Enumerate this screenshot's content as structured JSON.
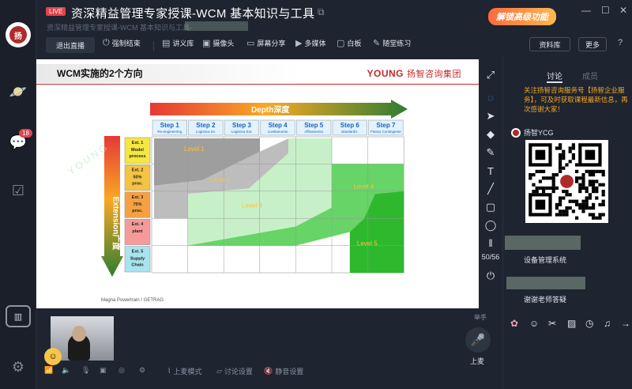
{
  "titlebar": {
    "live_badge": "LIVE",
    "title": "资深精益管理专家授课-WCM 基本知识与工具",
    "subtitle": "资深精益管理专家授课-WCM 基本知识与工具-",
    "promo": "解锁高级功能"
  },
  "toolbar": {
    "exit": "退出直播",
    "force_end": "强制结束",
    "courseware": "讲义库",
    "camera": "摄像头",
    "screen_share": "屏幕分享",
    "multimedia": "多媒体",
    "whiteboard": "白板",
    "quiz": "随堂练习",
    "resources": "资料库",
    "more": "更多"
  },
  "rail": {
    "badge": "18"
  },
  "slide": {
    "title": "WCM实施的2个方向",
    "brand": "YOUNG",
    "brand_cn": "扬智咨询集团",
    "footer": "Magna Powertrain / GETRAG",
    "depth_label": "Depth深度",
    "extension_label": "Extension广度",
    "watermark": "Y O U N G",
    "steps": [
      {
        "name": "Step 1",
        "sub": "Re-engineering"
      },
      {
        "name": "Step 2",
        "sub": "Logistica Int."
      },
      {
        "name": "Step 3",
        "sub": "Logistica Est."
      },
      {
        "name": "Step 4",
        "sub": "LivelIamonto"
      },
      {
        "name": "Step 5",
        "sub": "Affinamento"
      },
      {
        "name": "Step 6",
        "sub": "standardiz."
      },
      {
        "name": "Step 7",
        "sub": "Flusso Contingente"
      }
    ],
    "ext_rows": [
      {
        "name": "Ext. 1",
        "l1": "Model",
        "l2": "process",
        "color": "#f5e642"
      },
      {
        "name": "Ext. 2",
        "l1": "50%",
        "l2": "proc.",
        "color": "#f5c342"
      },
      {
        "name": "Ext. 3",
        "l1": "75%",
        "l2": "proc.",
        "color": "#f5a142"
      },
      {
        "name": "Ext. 4",
        "l1": "plant",
        "l2": "",
        "color": "#f59a9a"
      },
      {
        "name": "Ext. 5",
        "l1": "Supply",
        "l2": "Chain",
        "color": "#a8e4f0"
      }
    ],
    "levels": [
      "Level 1",
      "Level 2",
      "Level 3",
      "Level 4",
      "Level 5"
    ]
  },
  "vtools": {
    "page": "50/56"
  },
  "panel": {
    "tab_discuss": "讨论",
    "tab_members": "成员",
    "notice": "关注扬智咨询服务号【扬智企业服务】，可及时获取课程最新信息，再次感谢大家！",
    "sender": "扬智YCG",
    "msg1": "设备管理系统",
    "msg2": "谢谢老师答疑"
  },
  "bottom": {
    "raise_hand": "举手",
    "mic_label": "上麦",
    "mode": "上麦模式",
    "discussion_settings": "讨论设置",
    "mute_all": "静音设置"
  }
}
